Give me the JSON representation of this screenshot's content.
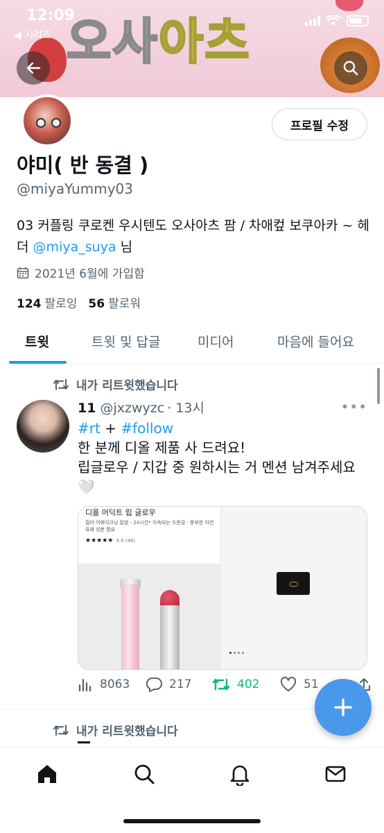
{
  "status_bar": {
    "time": "12:09",
    "back_app": "◀ 시리즈"
  },
  "banner": {
    "text_part1": "오사",
    "text_part2": "아츠"
  },
  "profile": {
    "edit_button": "프로필 수정",
    "display_name": "야미( 반 동결 )",
    "handle": "@miyaYummy03",
    "bio_text": "03 커플링 쿠로켄 우시텐도 오사아츠 팜 / 차애컾 보쿠아카 ~ 헤더 ",
    "bio_link": "@miya_suya",
    "bio_suffix": " 님",
    "joined": "2021년 6월에 가입함",
    "following_count": "124",
    "following_label": "팔로잉",
    "followers_count": "56",
    "followers_label": "팔로워"
  },
  "tabs": [
    "트윗",
    "트윗 및 답글",
    "미디어",
    "마음에 들어요"
  ],
  "tweets": [
    {
      "retweet_label": "내가 리트윗했습니다",
      "author_name": "11",
      "author_handle": "@jxzwyzc",
      "time": "· 13시",
      "hashtag1": "#rt",
      "plus": " + ",
      "hashtag2": "#follow",
      "line2": "한 분께 디올 제품 사 드려요!",
      "line3": "립글로우 / 지갑 중 원하시는 거 멘션 남겨주세요",
      "emoji": "🤍",
      "media": {
        "title": "디올 어딕트 립 글로우",
        "desc": "컬러 어웨이크닝 립밤 - 24시간* 지속되는 수분감 · 풍부한 자연 유래 성분 함유",
        "stars": "★★★★★",
        "rating": "4.9 (46)"
      },
      "views": "8063",
      "replies": "217",
      "retweets": "402",
      "likes": "51"
    },
    {
      "retweet_label": "내가 리트윗했습니다"
    }
  ],
  "colors": {
    "accent": "#1d9bf0",
    "retweet_green": "#00ba7c",
    "fab": "#4a98e9",
    "banner_pink": "#f1c8d6"
  },
  "icons": [
    "back-arrow-icon",
    "search-icon",
    "calendar-icon",
    "retweet-icon",
    "views-icon",
    "reply-icon",
    "like-icon",
    "share-icon",
    "compose-plus-icon",
    "home-icon",
    "explore-icon",
    "notifications-icon",
    "messages-icon"
  ]
}
